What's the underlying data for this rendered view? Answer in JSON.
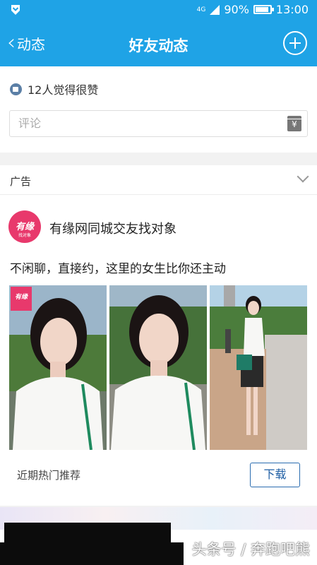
{
  "status_bar": {
    "network": "4G",
    "battery": "90%",
    "time": "13:00"
  },
  "nav": {
    "back_label": "动态",
    "title": "好友动态"
  },
  "likes": {
    "text": "12人觉得很赞"
  },
  "comment": {
    "placeholder": "评论",
    "button_icon": "¥"
  },
  "ad": {
    "label": "广告",
    "logo_text": "有缘",
    "logo_subtext": "找对象",
    "advertiser": "有缘网同城交友找对象",
    "text": "不闲聊，直接约，这里的女生比你还主动",
    "photo_badge": "有缘",
    "footer_text": "近期热门推荐",
    "download_label": "下载"
  },
  "watermark": "头条号 / 奔跑吧熊",
  "colors": {
    "brand_blue": "#1fa3e6",
    "ad_pink": "#e8396c",
    "button_blue": "#1d5da3"
  }
}
